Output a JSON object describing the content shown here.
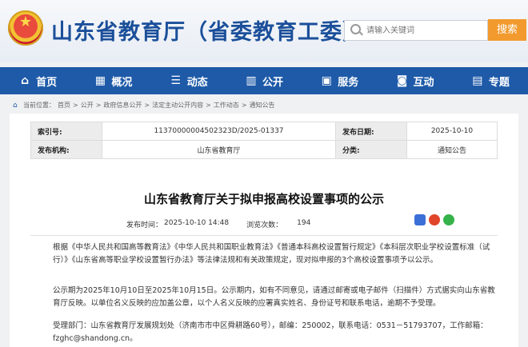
{
  "header": {
    "site_title": "山东省教育厅（省委教育工委）",
    "search_placeholder": "请输入关键词",
    "search_button": "搜索"
  },
  "nav": [
    {
      "label": "首页",
      "icon": "home-icon"
    },
    {
      "label": "概况",
      "icon": "building-icon"
    },
    {
      "label": "动态",
      "icon": "news-icon"
    },
    {
      "label": "公开",
      "icon": "book-icon"
    },
    {
      "label": "服务",
      "icon": "service-icon"
    },
    {
      "label": "互动",
      "icon": "chat-icon"
    },
    {
      "label": "专题",
      "icon": "document-icon"
    }
  ],
  "breadcrumb": [
    "当前位置：",
    "首页",
    "公开",
    "政府信息公开",
    "法定主动公开内容",
    "工作动态",
    "通知公告"
  ],
  "meta": {
    "index_label": "索引号:",
    "index_value": "11370000004502323D/2025-01337",
    "date_label": "发布日期:",
    "date_value": "2025-10-10",
    "org_label": "发布机构:",
    "org_value": "山东省教育厅",
    "cat_label": "分类:",
    "cat_value": "通知公告"
  },
  "article": {
    "title": "山东省教育厅关于拟申报高校设置事项的公示",
    "pub_time_label": "发布时间：",
    "pub_time": "2025-10-10 14:48",
    "views_label": "浏览次数：",
    "views": "194",
    "p1": "根据《中华人民共和国高等教育法》《中华人民共和国职业教育法》《普通本科高校设置暂行规定》《本科层次职业学校设置标准（试行）》《山东省高等职业学校设置暂行办法》等法律法规和有关政策规定，现对拟申报的3个高校设置事项予以公示。",
    "p2": "公示期为2025年10月10日至2025年10月15日。公示期内，如有不同意见，请通过邮寄或电子邮件（扫描件）方式据实向山东省教育厅反映。以单位名义反映的应加盖公章，以个人名义反映的应署真实姓名、身份证号和联系电话，逾期不予受理。",
    "p3": "受理部门：山东省教育厅发展规划处（济南市市中区舜耕路60号），邮编：250002，联系电话：0531－51793707，工作邮箱：fzghc@shandong.cn。"
  }
}
